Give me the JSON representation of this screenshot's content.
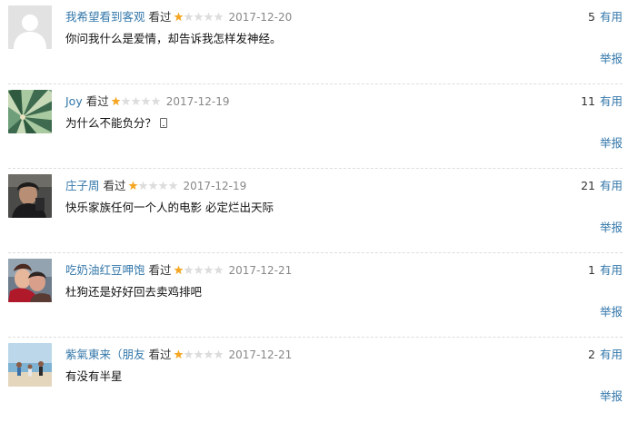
{
  "comments": [
    {
      "user": "我希望看到客观",
      "watched": "看过",
      "rating": 1,
      "max_rating": 5,
      "date": "2017-12-20",
      "votes": "5",
      "useful_label": "有用",
      "text": "你问我什么是爱情，却告诉我怎样发神经。",
      "report_label": "举报",
      "avatar": "default-avatar"
    },
    {
      "user": "Joy",
      "watched": "看过",
      "rating": 1,
      "max_rating": 5,
      "date": "2017-12-19",
      "votes": "11",
      "useful_label": "有用",
      "text": "为什么不能负分？",
      "report_label": "举报",
      "avatar": "umbrella-photo"
    },
    {
      "user": "庄子周",
      "watched": "看过",
      "rating": 1,
      "max_rating": 5,
      "date": "2017-12-19",
      "votes": "21",
      "useful_label": "有用",
      "text": "快乐家族任何一个人的电影 必定烂出天际",
      "report_label": "举报",
      "avatar": "portrait-photo"
    },
    {
      "user": "吃奶油红豆呷饱",
      "watched": "看过",
      "rating": 1,
      "max_rating": 5,
      "date": "2017-12-21",
      "votes": "1",
      "useful_label": "有用",
      "text": "杜狗还是好好回去卖鸡排吧",
      "report_label": "举报",
      "avatar": "couple-photo"
    },
    {
      "user": "紫氣東来（朋友",
      "watched": "看过",
      "rating": 1,
      "max_rating": 5,
      "date": "2017-12-21",
      "votes": "2",
      "useful_label": "有用",
      "text": "有没有半星",
      "report_label": "举报",
      "avatar": "beach-photo"
    }
  ],
  "colors": {
    "link": "#3377aa",
    "star_filled": "#f5a623",
    "star_empty": "#dddddd",
    "date": "#888888"
  }
}
